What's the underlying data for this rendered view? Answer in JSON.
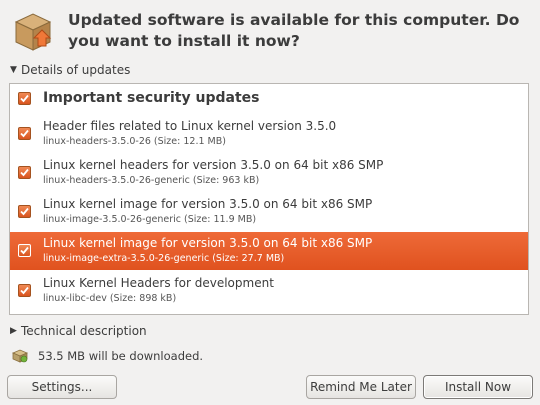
{
  "header": {
    "title": "Updated software is available for this computer. Do you want to install it now?"
  },
  "details_expander": {
    "label": "Details of updates",
    "expanded": true
  },
  "updates": {
    "category": {
      "label": "Important security updates",
      "checked": true
    },
    "items": [
      {
        "title": "Header files related to Linux kernel version 3.5.0",
        "package": "linux-headers-3.5.0-26 (Size: 12.1 MB)",
        "checked": true,
        "selected": false
      },
      {
        "title": "Linux kernel headers for version 3.5.0 on 64 bit x86 SMP",
        "package": "linux-headers-3.5.0-26-generic (Size: 963 kB)",
        "checked": true,
        "selected": false
      },
      {
        "title": "Linux kernel image for version 3.5.0 on 64 bit x86 SMP",
        "package": "linux-image-3.5.0-26-generic (Size: 11.9 MB)",
        "checked": true,
        "selected": false
      },
      {
        "title": "Linux kernel image for version 3.5.0 on 64 bit x86 SMP",
        "package": "linux-image-extra-3.5.0-26-generic (Size: 27.7 MB)",
        "checked": true,
        "selected": true
      },
      {
        "title": "Linux Kernel Headers for development",
        "package": "linux-libc-dev (Size: 898 kB)",
        "checked": true,
        "selected": false
      }
    ]
  },
  "technical_expander": {
    "label": "Technical description",
    "expanded": false
  },
  "download": {
    "text": "53.5 MB will be downloaded."
  },
  "buttons": {
    "settings": "Settings...",
    "remind": "Remind Me Later",
    "install": "Install Now"
  },
  "colors": {
    "accent": "#e95420",
    "selected_row": "#e65a25",
    "window_bg": "#f2f1f0"
  },
  "icons": {
    "app": "software-update-box-icon",
    "download": "package-icon"
  }
}
